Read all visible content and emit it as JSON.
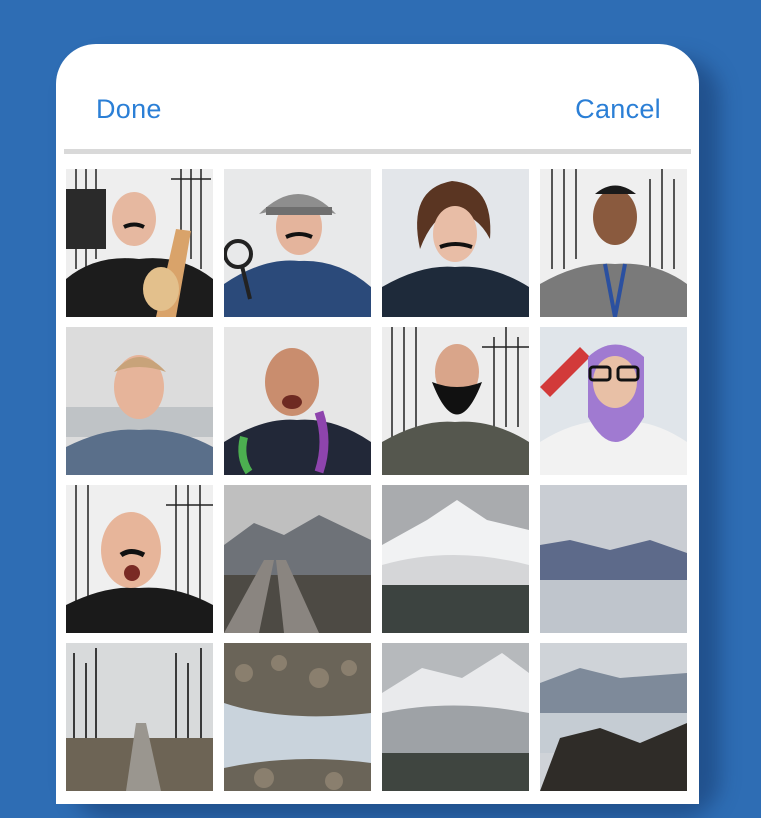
{
  "header": {
    "done_label": "Done",
    "cancel_label": "Cancel"
  },
  "colors": {
    "background": "#2e6db4",
    "accent": "#2b7fd6",
    "divider": "#d9d9d9"
  },
  "photos": [
    {
      "kind": "portrait",
      "subject": "man-with-ukulele-and-moustache"
    },
    {
      "kind": "portrait",
      "subject": "man-detective-hat-magnifier"
    },
    {
      "kind": "portrait",
      "subject": "woman-with-moustache"
    },
    {
      "kind": "portrait",
      "subject": "man-smiling-lanyard"
    },
    {
      "kind": "portrait",
      "subject": "man-smiling-office"
    },
    {
      "kind": "portrait",
      "subject": "bald-man-feather-boa"
    },
    {
      "kind": "portrait",
      "subject": "man-with-fake-beard"
    },
    {
      "kind": "portrait",
      "subject": "woman-in-costume-glasses"
    },
    {
      "kind": "portrait",
      "subject": "man-with-moustache-surprised"
    },
    {
      "kind": "landscape",
      "subject": "railroad-tracks-mountains"
    },
    {
      "kind": "landscape",
      "subject": "snowy-mountain-fog"
    },
    {
      "kind": "landscape",
      "subject": "mountains-across-water"
    },
    {
      "kind": "landscape",
      "subject": "road-through-bare-trees"
    },
    {
      "kind": "landscape",
      "subject": "rocky-stream"
    },
    {
      "kind": "landscape",
      "subject": "snowy-mountain-slope"
    },
    {
      "kind": "landscape",
      "subject": "rocks-by-lake-mountains"
    }
  ]
}
